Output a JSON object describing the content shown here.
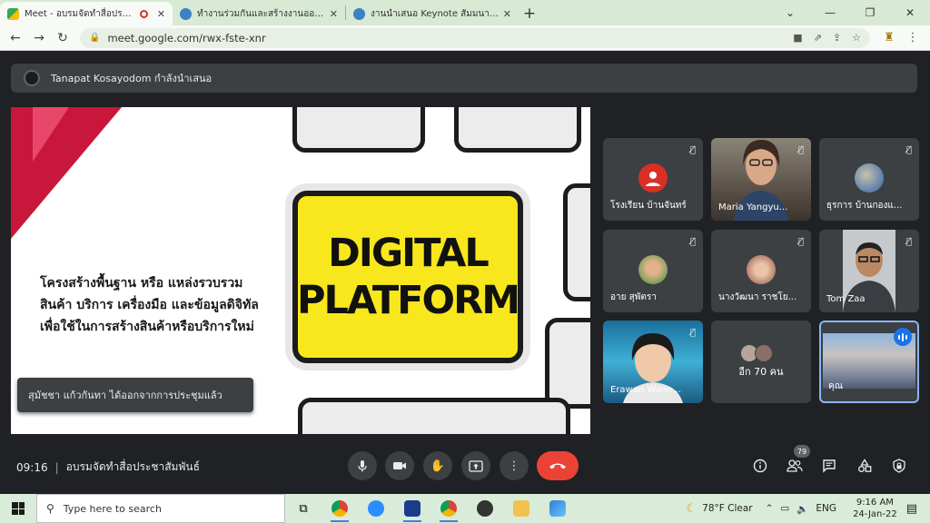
{
  "browser": {
    "tabs": [
      {
        "title": "Meet - อบรมจัดทำสื่อประชาสัมพันธ์",
        "favicon_color": "#34a853",
        "recording": true
      },
      {
        "title": "ทำงานร่วมกันและสร้างงานออกแบบกราฟิก",
        "favicon_color": "#3b82c4",
        "recording": false
      },
      {
        "title": "งานนำเสนอ Keynote สัมมนาผ่านเว็บ",
        "favicon_color": "#3b82c4",
        "recording": false
      }
    ],
    "new_tab": "+",
    "url": "meet.google.com/rwx-fste-xnr"
  },
  "meet": {
    "presenter_banner": "Tanapat Kosayodom กำลังนำเสนอ",
    "slide": {
      "key_line1": "DIGITAL",
      "key_line2": "PLATFORM",
      "text_line1": "โครงสร้างพื้นฐาน หรือ แหล่งรวบรวม",
      "text_line2": "สินค้า บริการ เครื่องมือ และข้อมูลดิจิทัล",
      "text_line3": "เพื่อใช้ในการสร้างสินค้าหรือบริการใหม่"
    },
    "toast": "สุมัชชา แก้วกันทา ได้ออกจากการประชุมแล้ว",
    "participants": [
      {
        "name": "โรงเรียน บ้านจันทร์",
        "type": "avatar",
        "color": "#d93025"
      },
      {
        "name": "Maria Yangyu...",
        "type": "video",
        "color": "#6b5a52"
      },
      {
        "name": "ธุรการ บ้านกองแ...",
        "type": "avatar",
        "color": "#5b7fb0"
      },
      {
        "name": "อาย สุพัตรา",
        "type": "avatar",
        "color": "#7fa05b"
      },
      {
        "name": "นางวัฒนา ราชโย...",
        "type": "avatar",
        "color": "#b07a6a"
      },
      {
        "name": "Tom Zaa",
        "type": "video",
        "color": "#bfc3c6"
      },
      {
        "name": "Erawan Wann...",
        "type": "video",
        "color": "#2a8fb0"
      },
      {
        "name": "อีก 70 คน",
        "type": "more",
        "color": "#3c4043"
      },
      {
        "name": "คุณ",
        "type": "self",
        "color": "#6f8fb8"
      }
    ],
    "participant_count": "79",
    "time": "09:16",
    "meeting_title": "อบรมจัดทำสื่อประชาสัมพันธ์"
  },
  "taskbar": {
    "search_placeholder": "Type here to search",
    "weather": "78°F  Clear",
    "language": "ENG",
    "clock_time": "9:16 AM",
    "clock_date": "24-Jan-22"
  },
  "colors": {
    "end_call": "#ea4335",
    "accent": "#1a73e8",
    "meet_bg": "#202124"
  }
}
